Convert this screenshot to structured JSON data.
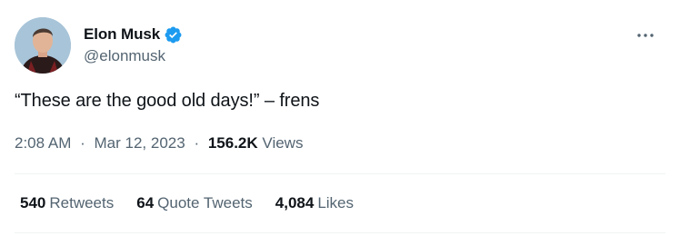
{
  "author": {
    "display_name": "Elon Musk",
    "handle": "@elonmusk",
    "verified_color": "#1d9bf0",
    "avatar_icon": "avatar-photo"
  },
  "tweet": {
    "text": "“These are the good old days!” – frens"
  },
  "meta": {
    "time": "2:08 AM",
    "separator": "·",
    "date": "Mar 12, 2023",
    "views_count": "156.2K",
    "views_label": "Views"
  },
  "stats": {
    "retweets_count": "540",
    "retweets_label": "Retweets",
    "quotes_count": "64",
    "quotes_label": "Quote Tweets",
    "likes_count": "4,084",
    "likes_label": "Likes"
  },
  "icons": {
    "more": "more-icon",
    "verified": "verified-badge-icon"
  }
}
